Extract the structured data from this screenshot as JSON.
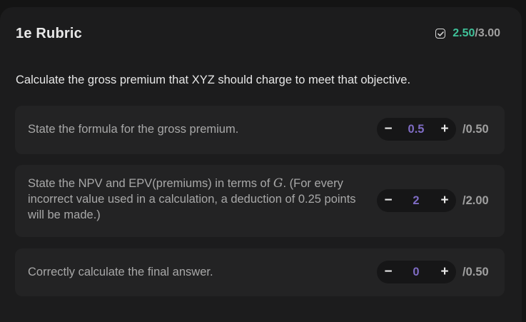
{
  "rubric": {
    "title": "1e Rubric",
    "score_earned": "2.50",
    "score_total": "/3.00",
    "question": "Calculate the gross premium that XYZ should charge to meet that objective."
  },
  "items": [
    {
      "text": "State the formula for the gross premium.",
      "value": "0.5",
      "max": "/0.50"
    },
    {
      "text_before": "State the NPV and EPV(premiums) in terms of ",
      "math": "G",
      "text_after": ". (For every incorrect value used in a calculation, a deduction of 0.25 points will be made.)",
      "value": "2",
      "max": "/2.00"
    },
    {
      "text": "Correctly calculate the final answer.",
      "value": "0",
      "max": "/0.50"
    }
  ],
  "stepper": {
    "minus": "−",
    "plus": "+"
  },
  "colors": {
    "earned": "#3fc199",
    "stepper_value": "#7f6cc4",
    "card_bg": "#1c1c1d",
    "item_bg": "#232324"
  },
  "icons": {
    "score": "checkbox-check-icon"
  }
}
